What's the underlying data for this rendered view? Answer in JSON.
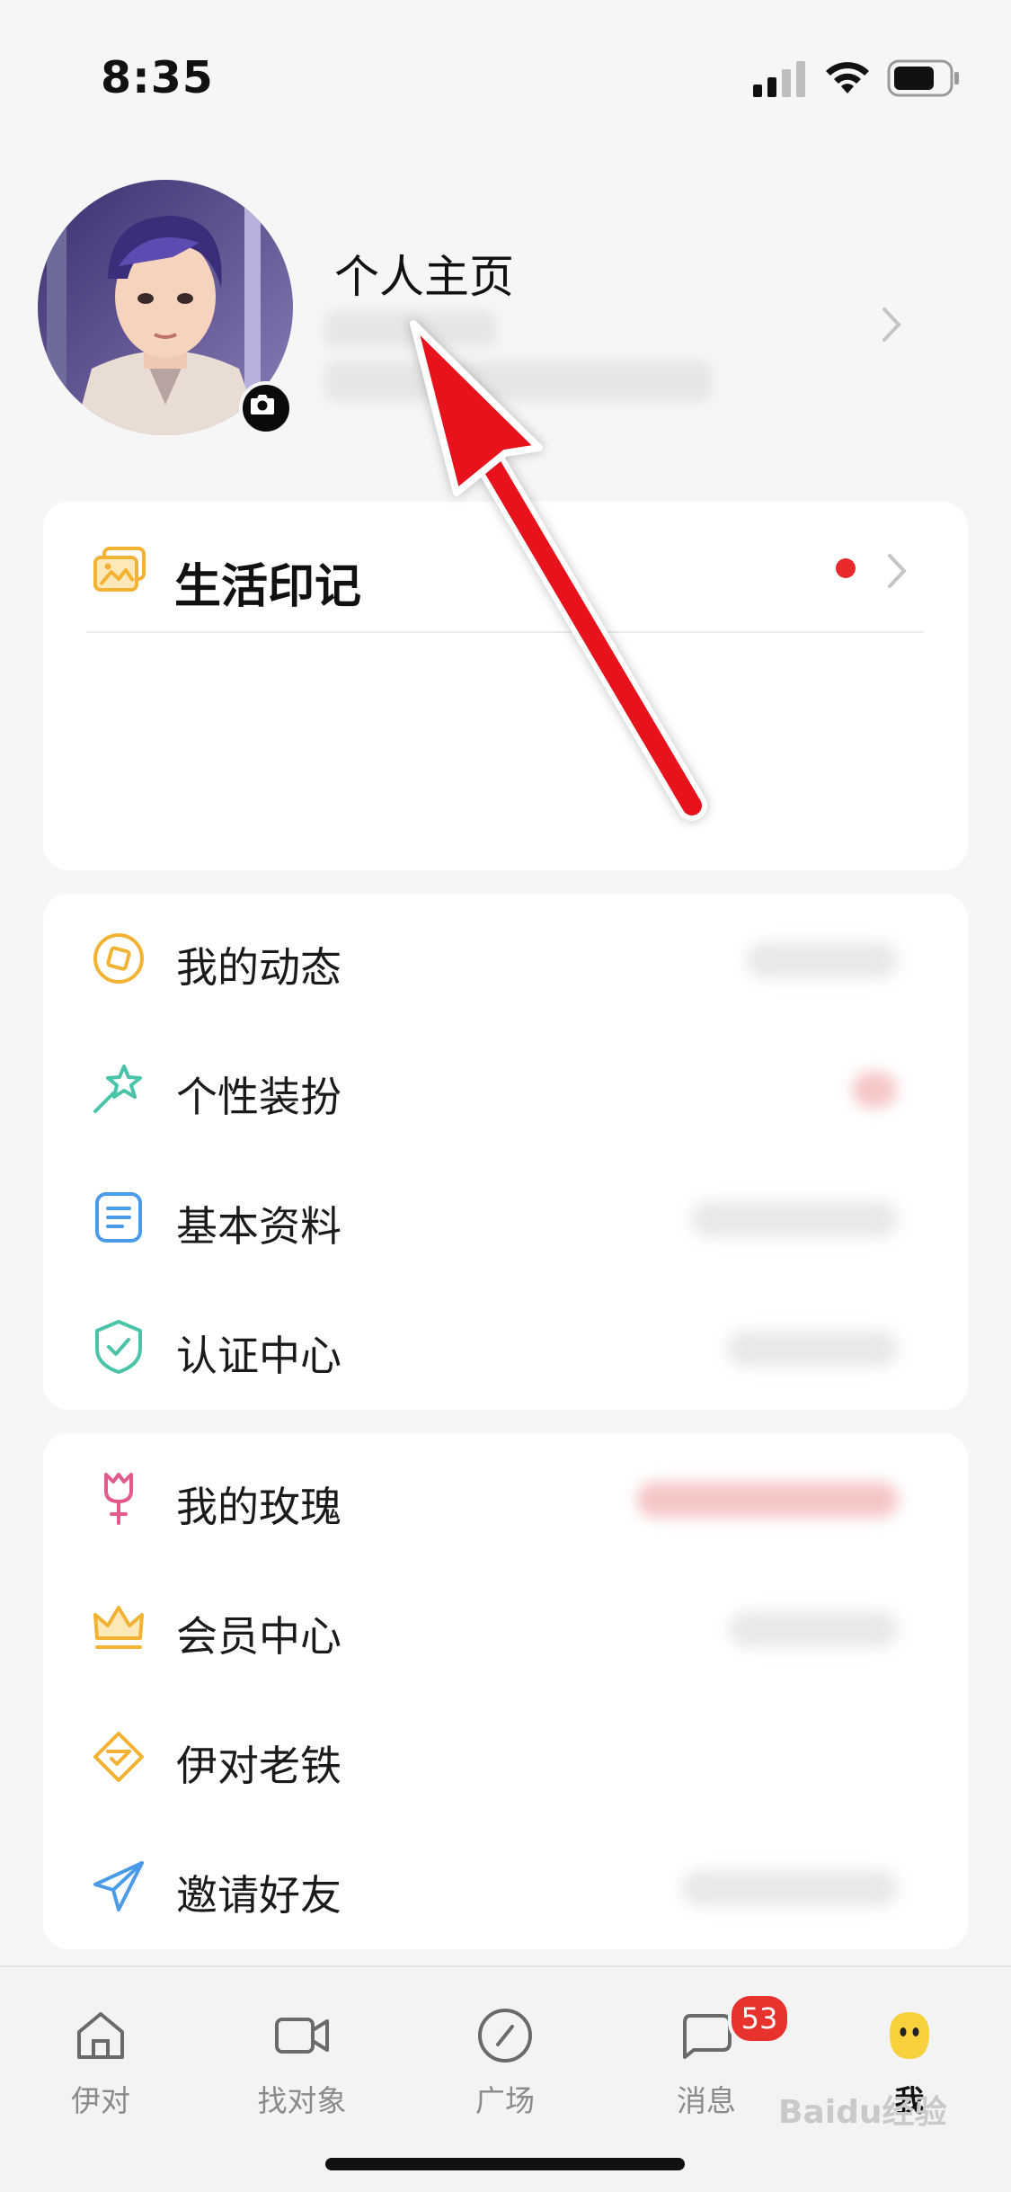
{
  "status_bar": {
    "time": "8:35"
  },
  "profile": {
    "title": "个人主页"
  },
  "life_card": {
    "title": "生活印记",
    "has_notification": true
  },
  "menu_group_1": [
    {
      "label": "我的动态",
      "icon": "compass-icon"
    },
    {
      "label": "个性装扮",
      "icon": "magic-wand-icon"
    },
    {
      "label": "基本资料",
      "icon": "document-icon"
    },
    {
      "label": "认证中心",
      "icon": "shield-check-icon"
    }
  ],
  "menu_group_2": [
    {
      "label": "我的玫瑰",
      "icon": "rose-icon"
    },
    {
      "label": "会员中心",
      "icon": "crown-icon"
    },
    {
      "label": "伊对老铁",
      "icon": "diamond-check-icon"
    },
    {
      "label": "邀请好友",
      "icon": "paper-plane-icon"
    }
  ],
  "tab_bar": {
    "tabs": [
      {
        "label": "伊对",
        "icon": "home-icon"
      },
      {
        "label": "找对象",
        "icon": "video-camera-icon"
      },
      {
        "label": "广场",
        "icon": "compass-icon"
      },
      {
        "label": "消息",
        "icon": "chat-bubble-icon",
        "badge": "53"
      },
      {
        "label": "我",
        "icon": "face-avatar-icon",
        "active": true
      }
    ]
  },
  "watermark": "Baidu经验",
  "colors": {
    "accent_yellow": "#f2b233",
    "notification_red": "#e8322d",
    "arrow_red": "#e8121c",
    "teal": "#4ac4a8",
    "blue": "#4a9be8",
    "pink": "#e45a8a"
  }
}
